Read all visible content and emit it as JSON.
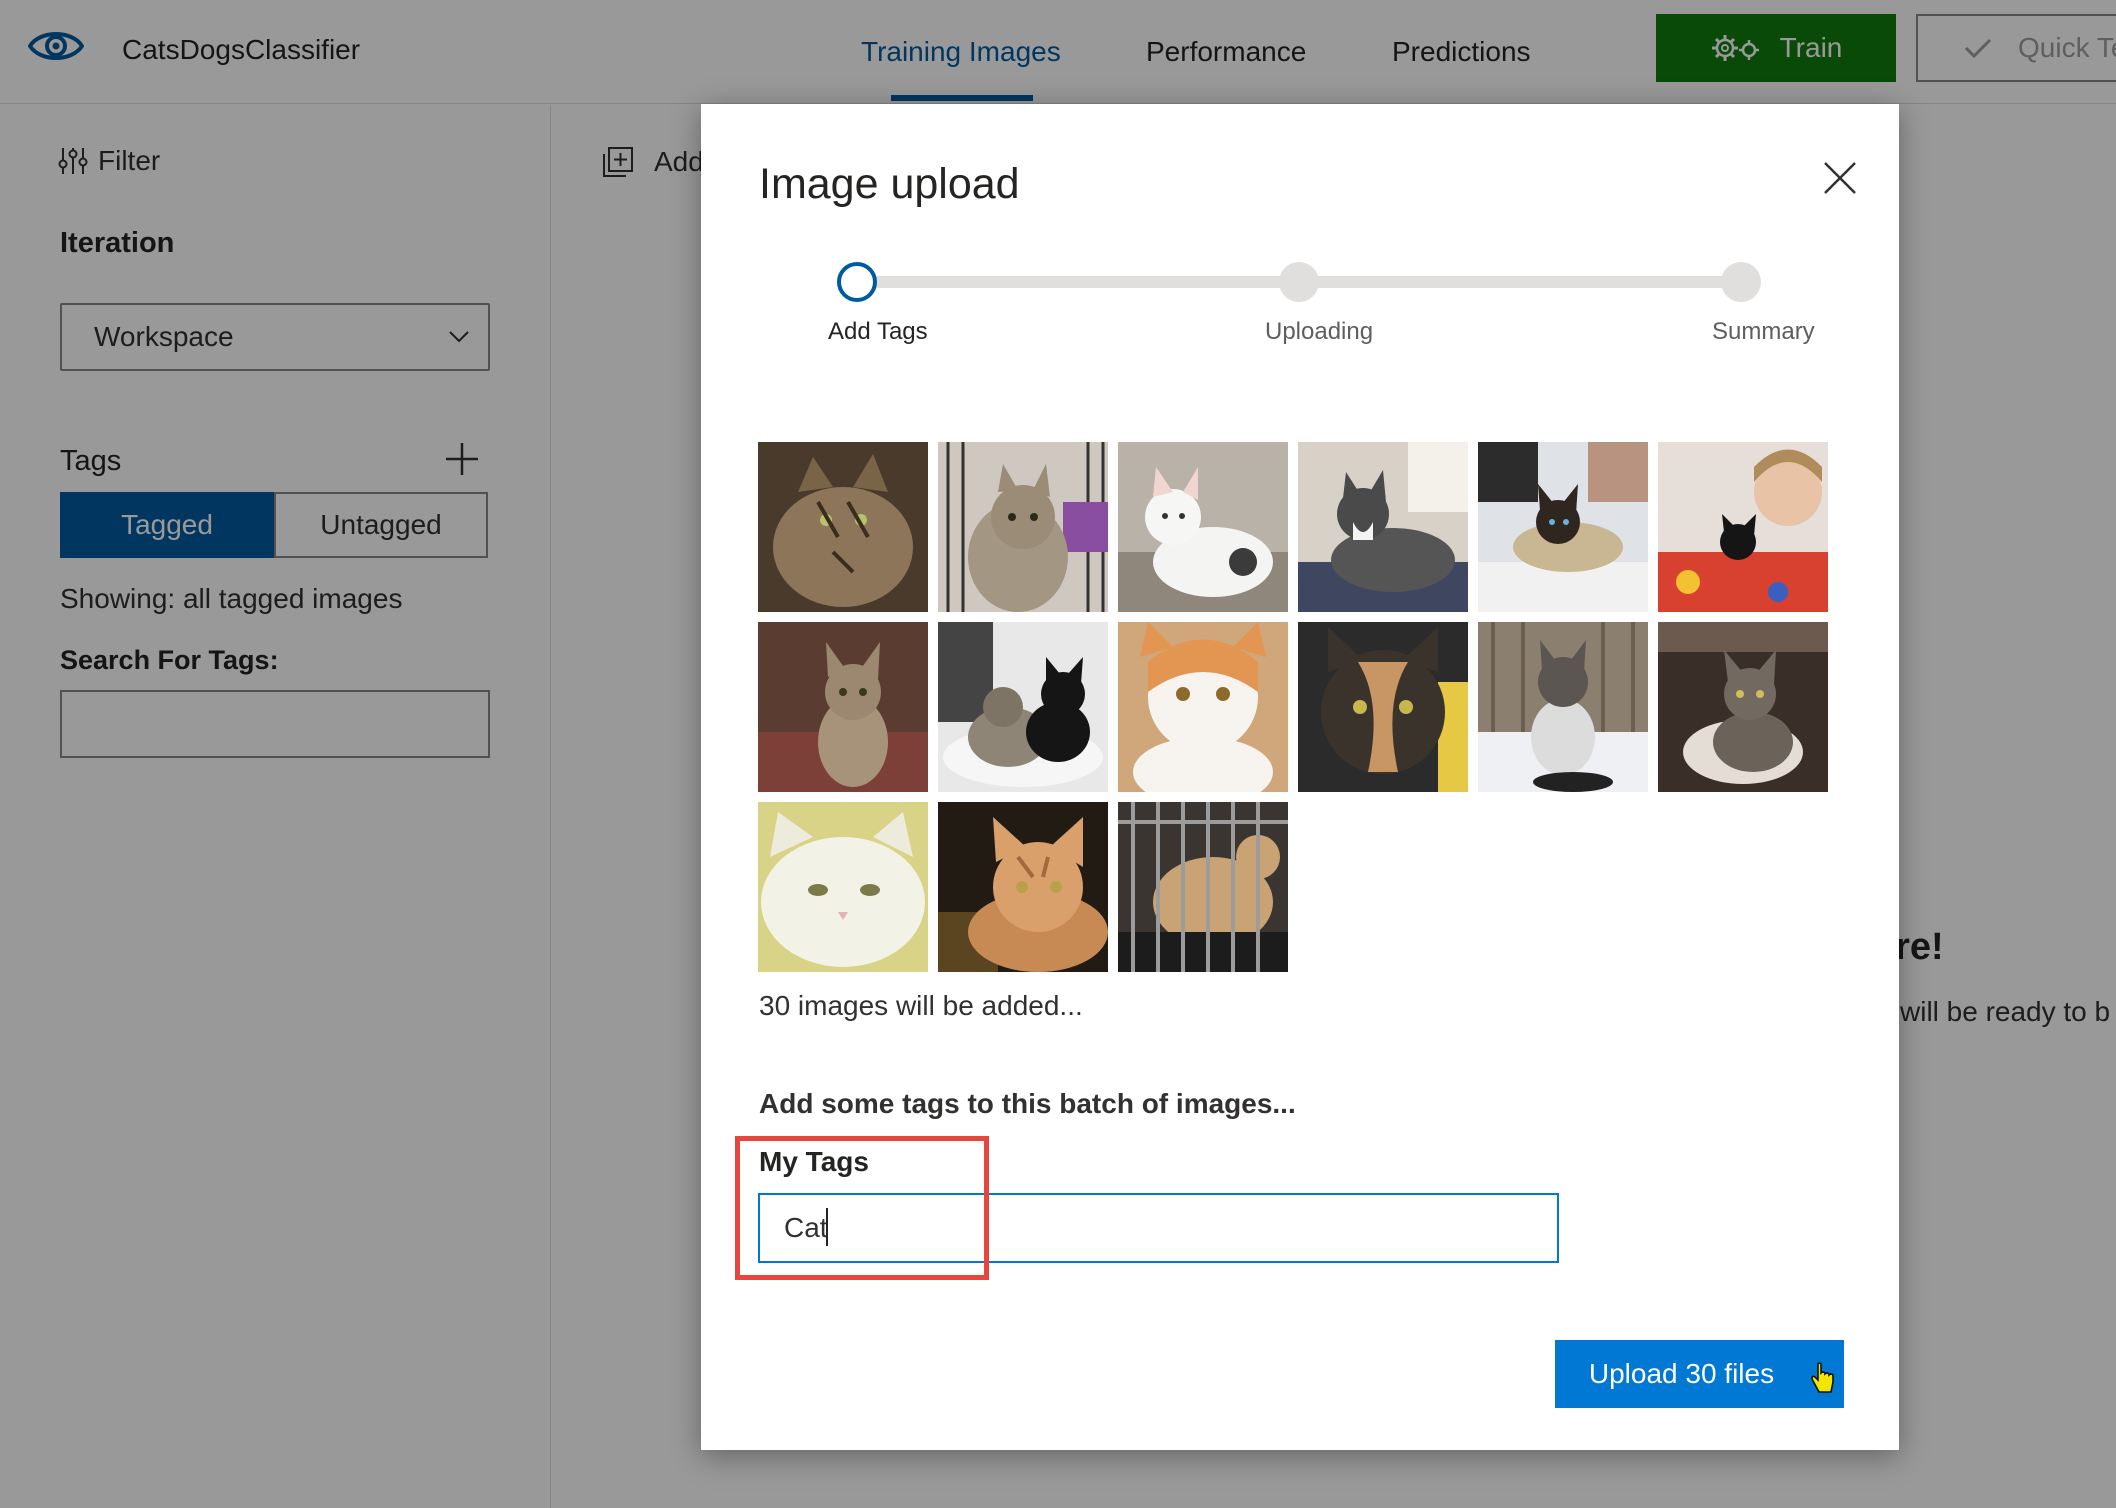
{
  "header": {
    "project_name": "CatsDogsClassifier",
    "tabs": [
      {
        "label": "Training Images",
        "active": true
      },
      {
        "label": "Performance",
        "active": false
      },
      {
        "label": "Predictions",
        "active": false
      }
    ],
    "train_label": "Train",
    "quick_test_label": "Quick Te"
  },
  "sidebar": {
    "filter_label": "Filter",
    "iteration_label": "Iteration",
    "iteration_value": "Workspace",
    "tags_label": "Tags",
    "segment": {
      "tagged": "Tagged",
      "untagged": "Untagged",
      "selected": "Tagged"
    },
    "showing_text": "Showing: all tagged images",
    "search_label": "Search For Tags:",
    "search_value": ""
  },
  "main": {
    "add_images_label": "Add",
    "empty_title": "ere!",
    "empty_text": "will be ready to b"
  },
  "modal": {
    "title": "Image upload",
    "steps": [
      {
        "label": "Add Tags",
        "state": "active"
      },
      {
        "label": "Uploading",
        "state": "pending"
      },
      {
        "label": "Summary",
        "state": "pending"
      }
    ],
    "thumbnails": [
      {
        "icon": "tabby-cat-photo"
      },
      {
        "icon": "tabby-kitten-in-cage-photo"
      },
      {
        "icon": "white-kitten-photo"
      },
      {
        "icon": "black-white-cat-photo"
      },
      {
        "icon": "siamese-cat-photo"
      },
      {
        "icon": "child-with-kitten-photo"
      },
      {
        "icon": "tabby-kitten-on-rug-photo"
      },
      {
        "icon": "two-cats-photo"
      },
      {
        "icon": "orange-white-cat-photo"
      },
      {
        "icon": "tortoiseshell-cat-photo"
      },
      {
        "icon": "kitten-in-snow-photo"
      },
      {
        "icon": "tabby-kitten-photo"
      },
      {
        "icon": "white-cat-photo"
      },
      {
        "icon": "orange-tabby-photo"
      },
      {
        "icon": "cat-in-cage-photo"
      }
    ],
    "count_text": "30 images will be added...",
    "batch_text": "Add some tags to this batch of images...",
    "my_tags_label": "My Tags",
    "tag_value": "Cat",
    "upload_label": "Upload 30 files"
  },
  "colors": {
    "accent": "#005a9e",
    "primary_button": "#0078d4",
    "train_button": "#107c10",
    "highlight": "#e8453c"
  }
}
